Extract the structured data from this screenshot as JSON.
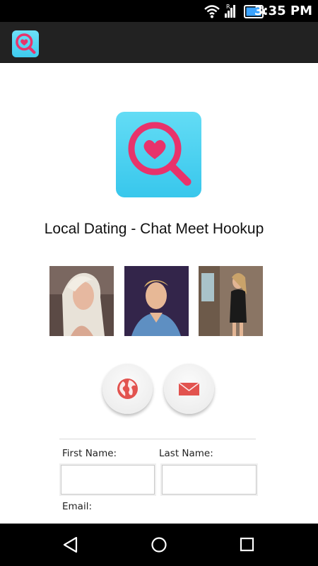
{
  "status_bar": {
    "time": "3:35 PM",
    "icons": [
      "wifi-icon",
      "signal-icon",
      "battery-icon"
    ],
    "roaming_indicator": "R"
  },
  "app": {
    "title": "Local Dating - Chat Meet Hookup",
    "accent_color": "#e8336b",
    "icon_background": "#4fd3f2"
  },
  "photos": [
    {
      "name": "profile-photo-1"
    },
    {
      "name": "profile-photo-2"
    },
    {
      "name": "profile-photo-3"
    }
  ],
  "actions": {
    "website_icon": "globe-icon",
    "email_icon": "envelope-icon",
    "icon_color": "#e2534f"
  },
  "form": {
    "first_name_label": "First Name:",
    "last_name_label": "Last Name:",
    "email_label": "Email:",
    "first_name_value": "",
    "last_name_value": ""
  },
  "nav": {
    "icons": [
      "back-icon",
      "home-icon",
      "recents-icon"
    ]
  }
}
